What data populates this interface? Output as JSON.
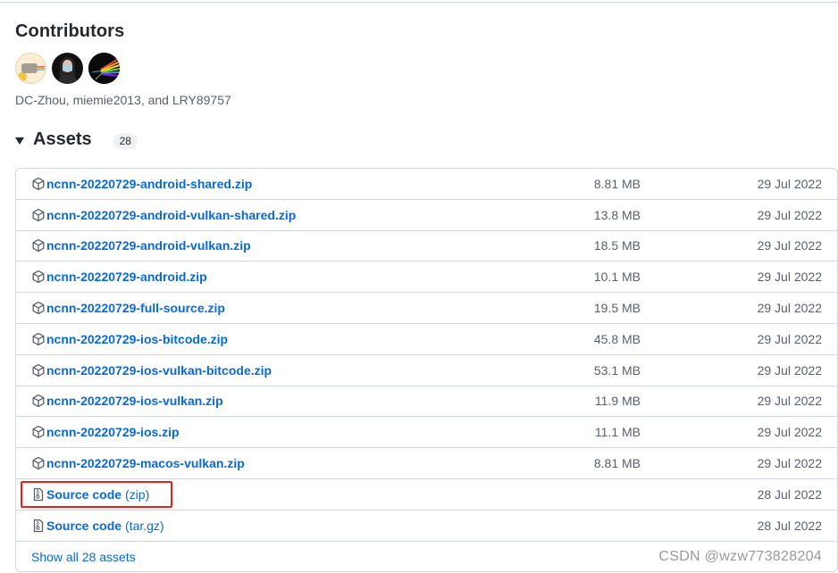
{
  "contributors": {
    "title": "Contributors",
    "avatars": [
      {
        "user": "DC-Zhou",
        "icon": "avatar-cat-icon"
      },
      {
        "user": "miemie2013",
        "icon": "avatar-person-icon"
      },
      {
        "user": "LRY89757",
        "icon": "avatar-prism-icon"
      }
    ],
    "names_text": "DC-Zhou, miemie2013, and LRY89757"
  },
  "assets": {
    "title": "Assets",
    "count": "28",
    "items": [
      {
        "name": "ncnn-20220729-android-shared.zip",
        "size": "8.81 MB",
        "date": "29 Jul 2022",
        "icon": "package-icon"
      },
      {
        "name": "ncnn-20220729-android-vulkan-shared.zip",
        "size": "13.8 MB",
        "date": "29 Jul 2022",
        "icon": "package-icon"
      },
      {
        "name": "ncnn-20220729-android-vulkan.zip",
        "size": "18.5 MB",
        "date": "29 Jul 2022",
        "icon": "package-icon"
      },
      {
        "name": "ncnn-20220729-android.zip",
        "size": "10.1 MB",
        "date": "29 Jul 2022",
        "icon": "package-icon"
      },
      {
        "name": "ncnn-20220729-full-source.zip",
        "size": "19.5 MB",
        "date": "29 Jul 2022",
        "icon": "package-icon"
      },
      {
        "name": "ncnn-20220729-ios-bitcode.zip",
        "size": "45.8 MB",
        "date": "29 Jul 2022",
        "icon": "package-icon"
      },
      {
        "name": "ncnn-20220729-ios-vulkan-bitcode.zip",
        "size": "53.1 MB",
        "date": "29 Jul 2022",
        "icon": "package-icon"
      },
      {
        "name": "ncnn-20220729-ios-vulkan.zip",
        "size": "11.9 MB",
        "date": "29 Jul 2022",
        "icon": "package-icon"
      },
      {
        "name": "ncnn-20220729-ios.zip",
        "size": "11.1 MB",
        "date": "29 Jul 2022",
        "icon": "package-icon"
      },
      {
        "name": "ncnn-20220729-macos-vulkan.zip",
        "size": "8.81 MB",
        "date": "29 Jul 2022",
        "icon": "package-icon"
      }
    ],
    "source_items": [
      {
        "name": "Source code",
        "suffix": "(zip)",
        "date": "28 Jul 2022",
        "icon": "file-zip-icon",
        "highlighted": true
      },
      {
        "name": "Source code",
        "suffix": "(tar.gz)",
        "date": "28 Jul 2022",
        "icon": "file-zip-icon",
        "highlighted": false
      }
    ],
    "show_all_label": "Show all 28 assets"
  },
  "watermark": "CSDN @wzw773828204",
  "colors": {
    "link": "#0969da",
    "muted": "#57606a",
    "border": "#d0d7de",
    "highlight": "#e8201c"
  }
}
